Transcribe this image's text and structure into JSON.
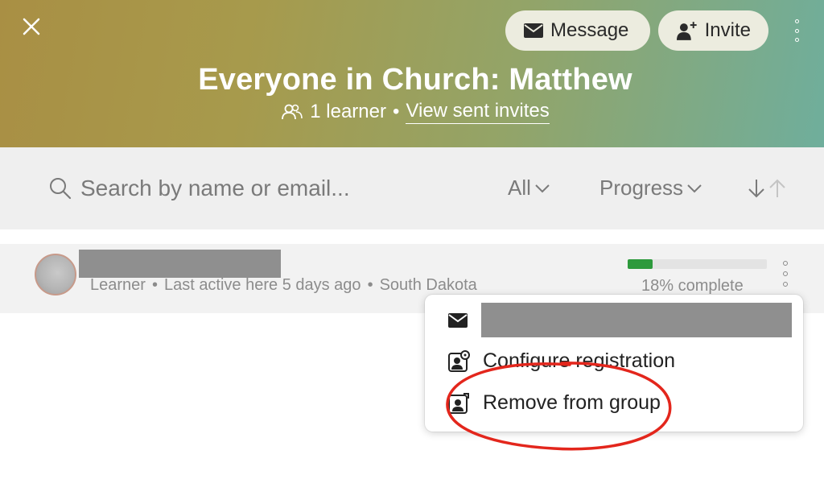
{
  "header": {
    "title": "Everyone in Church: Matthew",
    "learner_count": "1 learner",
    "separator": "•",
    "view_invites": "View sent invites",
    "message_label": "Message",
    "invite_label": "Invite",
    "gradient_colors": [
      "#a98f44",
      "#93a468",
      "#6fae9c"
    ]
  },
  "search": {
    "placeholder": "Search by name or email...",
    "filter_all": "All",
    "filter_progress": "Progress"
  },
  "learner_row": {
    "role": "Learner",
    "last_active": "Last active here 5 days ago",
    "location": "South Dakota",
    "progress_percent": 18,
    "progress_label": "18% complete",
    "progress_color": "#2d9a3c"
  },
  "context_menu": {
    "configure_label": "Configure registration",
    "remove_label": "Remove from group"
  },
  "annotation_color": "#e3261c"
}
